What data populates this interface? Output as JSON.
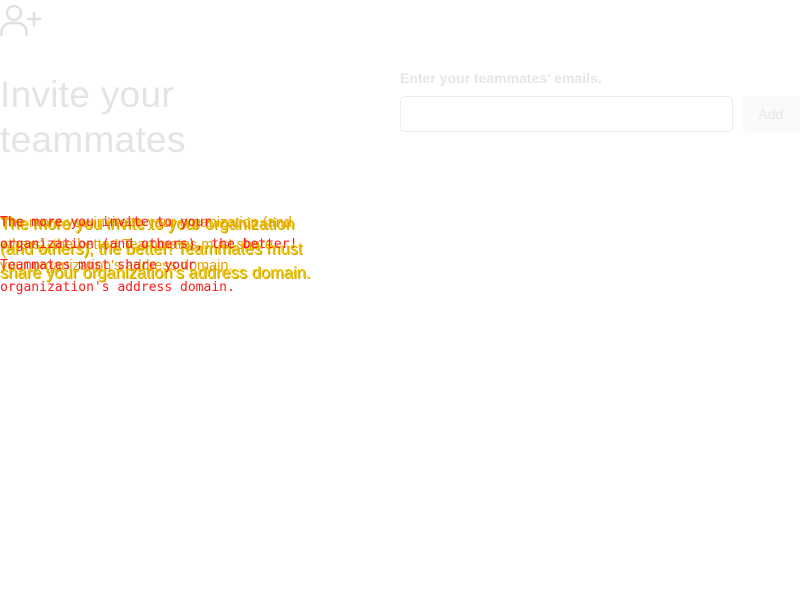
{
  "header": {
    "icon": "user-plus-icon"
  },
  "intro": {
    "title_line1": "Invite your",
    "title_line2": "teammates",
    "description": "The more you invite to your organization (and others), the better! Teammates must share your organization's address domain."
  },
  "invite_form": {
    "label": "Enter your teammates' emails.",
    "email_value": "",
    "email_placeholder": "",
    "add_label": "Add"
  },
  "colors": {
    "muted_text": "#e4e4e4",
    "overlay_yellow": "#f0c800",
    "overlay_red": "#ff1a1a"
  }
}
